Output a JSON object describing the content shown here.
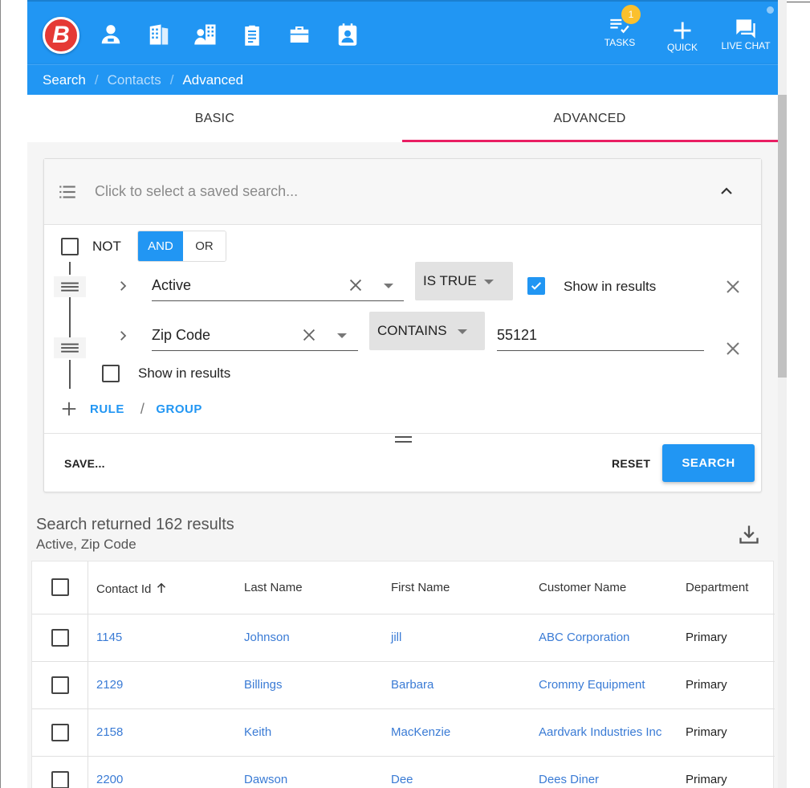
{
  "header": {
    "logo_letter": "B",
    "nav_icons": [
      "person-icon",
      "building-icon",
      "contacts-building-icon",
      "clipboard-icon",
      "briefcase-icon",
      "contact-card-icon"
    ],
    "tasks_label": "TASKS",
    "tasks_badge": "1",
    "quick_label": "QUICK",
    "live_chat_label": "LIVE CHAT",
    "accent_color": "#2196f3"
  },
  "breadcrumb": {
    "items": [
      "Search",
      "Contacts",
      "Advanced"
    ]
  },
  "tabs": [
    {
      "label": "BASIC",
      "active": false
    },
    {
      "label": "ADVANCED",
      "active": true
    }
  ],
  "saved_search": {
    "placeholder": "Click to select a saved search..."
  },
  "query": {
    "not_label": "NOT",
    "and_label": "AND",
    "or_label": "OR",
    "rules": [
      {
        "field": "Active",
        "operator": "IS TRUE",
        "show_label": "Show in results",
        "show_checked": true
      },
      {
        "field": "Zip Code",
        "operator": "CONTAINS",
        "value": "55121",
        "show_label": "Show in results",
        "show_checked": false
      }
    ],
    "add_rule": "RULE",
    "add_group": "GROUP",
    "slash": "/"
  },
  "footer": {
    "save_label": "SAVE...",
    "reset_label": "RESET",
    "search_label": "SEARCH"
  },
  "results": {
    "summary": "Search returned 162 results",
    "fields": "Active, Zip Code"
  },
  "table": {
    "columns": [
      "Contact Id",
      "Last Name",
      "First Name",
      "Customer Name",
      "Department"
    ],
    "rows": [
      {
        "id": "1145",
        "last": "Johnson",
        "first": "jill",
        "customer": "ABC Corporation",
        "dept": "Primary"
      },
      {
        "id": "2129",
        "last": "Billings",
        "first": "Barbara",
        "customer": "Crommy Equipment",
        "dept": "Primary"
      },
      {
        "id": "2158",
        "last": "Keith",
        "first": "MacKenzie",
        "customer": "Aardvark Industries Inc",
        "dept": "Primary"
      },
      {
        "id": "2200",
        "last": "Dawson",
        "first": "Dee",
        "customer": "Dees Diner",
        "dept": "Primary"
      }
    ]
  }
}
